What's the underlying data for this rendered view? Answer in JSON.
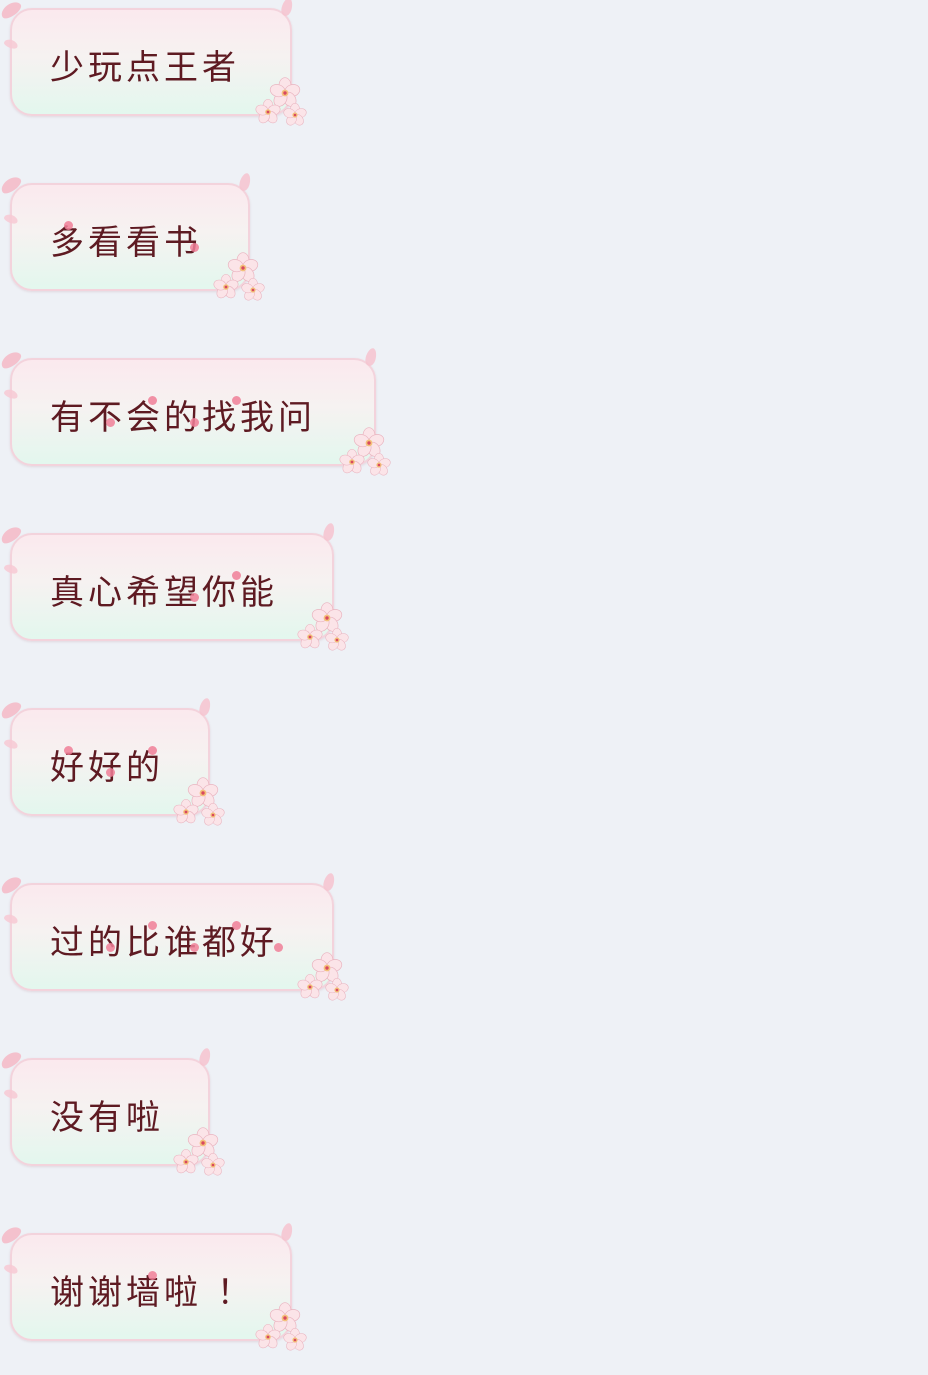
{
  "messages": [
    {
      "text": "少玩点王者"
    },
    {
      "text": "多看看书"
    },
    {
      "text": "有不会的找我问"
    },
    {
      "text": "真心希望你能"
    },
    {
      "text": "好好的"
    },
    {
      "text": "过的比谁都好"
    },
    {
      "text": "没有啦"
    },
    {
      "text": "谢谢墙啦 ！"
    }
  ],
  "colors": {
    "background": "#eef1f6",
    "bubble_top": "#fbe9ee",
    "bubble_bottom": "#e3f7ee",
    "bubble_border": "#f3d3dc",
    "text": "#5e1a22",
    "petal": "#f4b8c6",
    "dot": "#f07f98"
  },
  "icons": {
    "flower": "cherry-blossom-icon",
    "petal": "petal-icon"
  }
}
